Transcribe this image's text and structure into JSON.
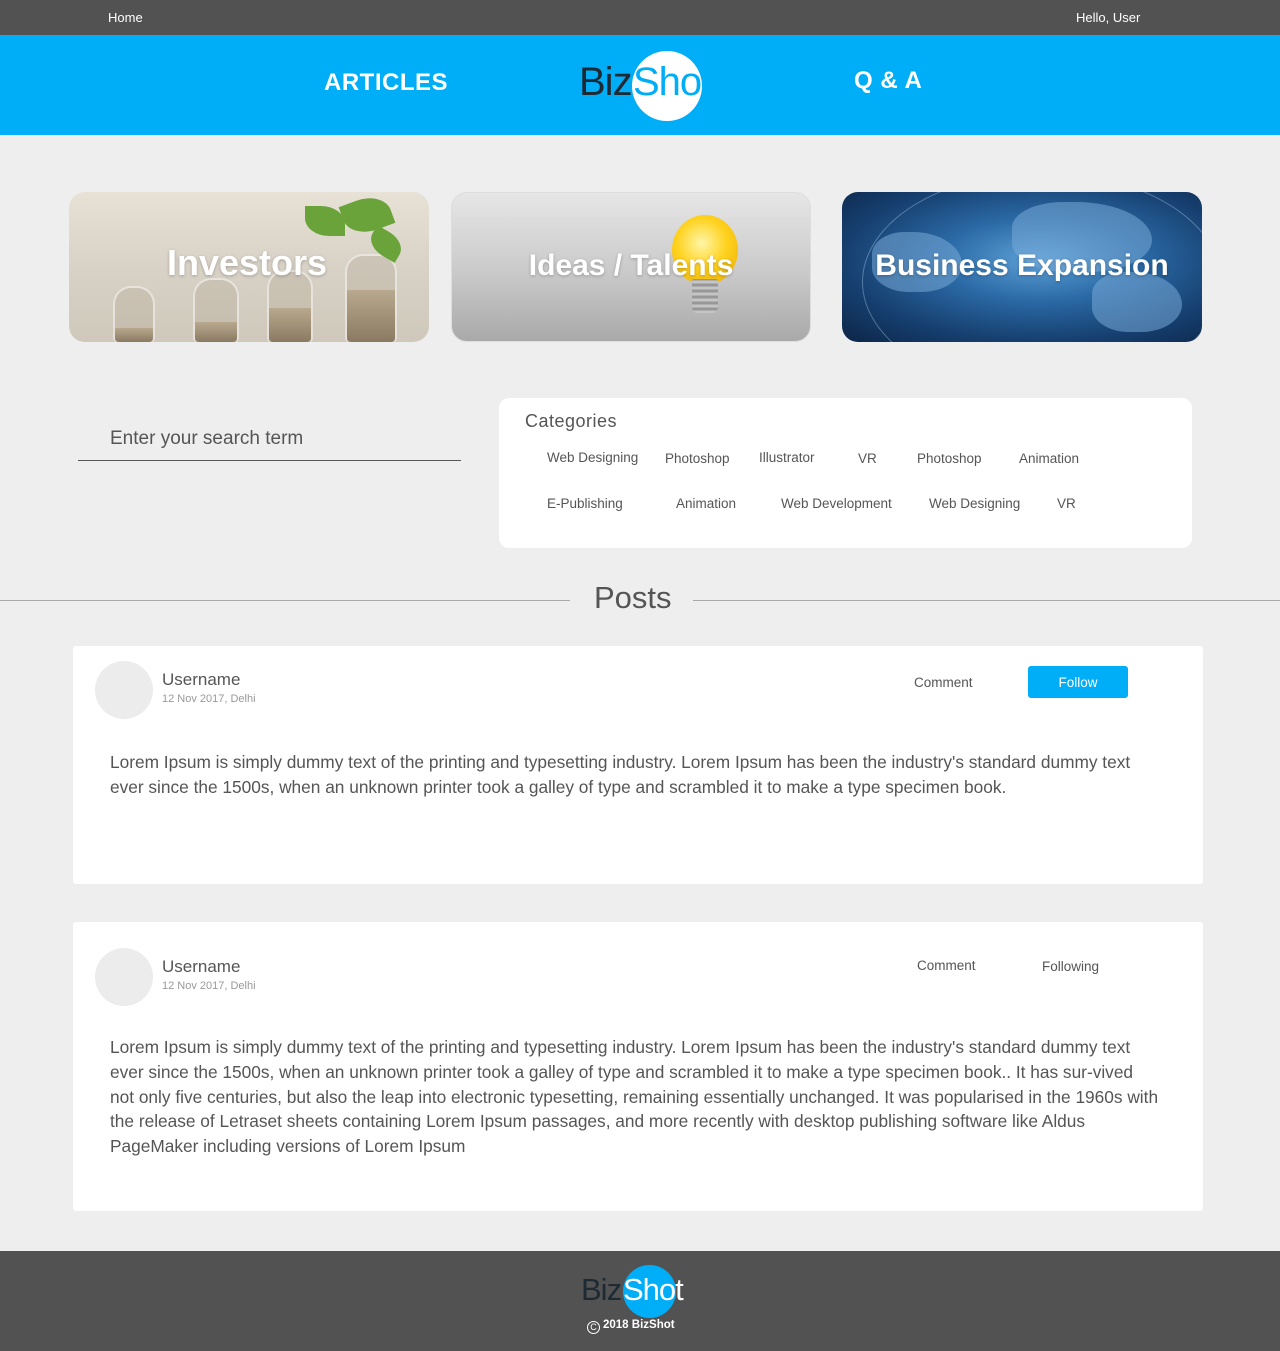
{
  "topbar": {
    "home": "Home",
    "greeting": "Hello, User"
  },
  "header": {
    "nav_left": "ARTICLES",
    "nav_right": "Q & A",
    "logo": {
      "part1": "Biz",
      "part2": "Shot"
    },
    "brand_color": "#00aef8"
  },
  "features": [
    {
      "label": "Investors"
    },
    {
      "label": "Ideas / Talents"
    },
    {
      "label": "Business Expansion"
    }
  ],
  "search": {
    "placeholder": "Enter your search term"
  },
  "categories": {
    "title": "Categories",
    "items": [
      "Web Designing",
      "Photoshop",
      "Illustrator",
      "VR",
      "Photoshop",
      "Animation",
      "E-Publishing",
      "Animation",
      "Web Development",
      "Web Designing",
      "VR"
    ]
  },
  "posts_heading": "Posts",
  "posts": [
    {
      "username": "Username",
      "meta": "12 Nov 2017, Delhi",
      "comment_label": "Comment",
      "follow_label": "Follow",
      "body": "Lorem Ipsum is simply dummy text of the printing and typesetting industry. Lorem Ipsum has been the industry's standard dummy text ever since the 1500s, when an unknown printer took a galley of type and scrambled it to make a type specimen book."
    },
    {
      "username": "Username",
      "meta": "12 Nov 2017, Delhi",
      "comment_label": "Comment",
      "follow_label": "Following",
      "body": "Lorem Ipsum is simply dummy text of the printing and typesetting industry. Lorem Ipsum has been the industry's standard dummy text ever since the 1500s, when an unknown printer took a galley of type and scrambled it to make a type specimen book.. It has sur-vived not only five centuries, but also the leap into electronic typesetting, remaining essentially unchanged. It was popularised in the 1960s with the release of Letraset sheets containing Lorem Ipsum passages, and more recently with desktop publishing software like Aldus PageMaker including versions of Lorem Ipsum"
    }
  ],
  "footer": {
    "logo": {
      "part1": "Biz",
      "part2": "Shot"
    },
    "copyright_symbol": "C",
    "copyright": "2018 BizShot"
  }
}
